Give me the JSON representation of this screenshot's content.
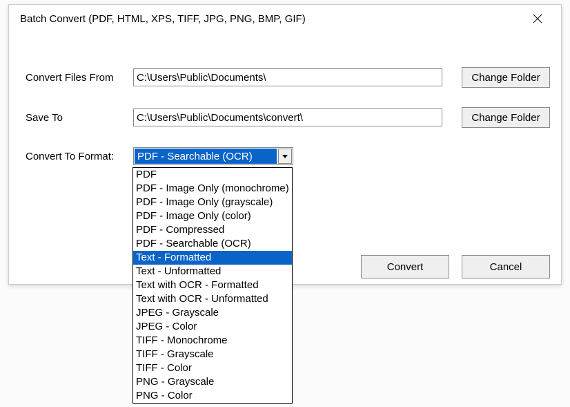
{
  "window": {
    "title": "Batch Convert (PDF, HTML, XPS, TIFF, JPG, PNG, BMP, GIF)"
  },
  "labels": {
    "convert_from": "Convert Files From",
    "save_to": "Save To",
    "convert_format": "Convert To Format:"
  },
  "inputs": {
    "from_path": "C:\\Users\\Public\\Documents\\",
    "save_path": "C:\\Users\\Public\\Documents\\convert\\"
  },
  "buttons": {
    "change_folder": "Change Folder",
    "convert": "Convert",
    "cancel": "Cancel"
  },
  "combo": {
    "selected": "PDF - Searchable (OCR)",
    "highlighted_index": 6,
    "options": [
      "PDF",
      "PDF - Image Only (monochrome)",
      "PDF - Image Only (grayscale)",
      "PDF - Image Only (color)",
      "PDF - Compressed",
      "PDF - Searchable (OCR)",
      "Text - Formatted",
      "Text - Unformatted",
      "Text with OCR - Formatted",
      "Text with OCR - Unformatted",
      "JPEG - Grayscale",
      "JPEG - Color",
      "TIFF - Monochrome",
      "TIFF - Grayscale",
      "TIFF - Color",
      "PNG - Grayscale",
      "PNG - Color"
    ]
  }
}
